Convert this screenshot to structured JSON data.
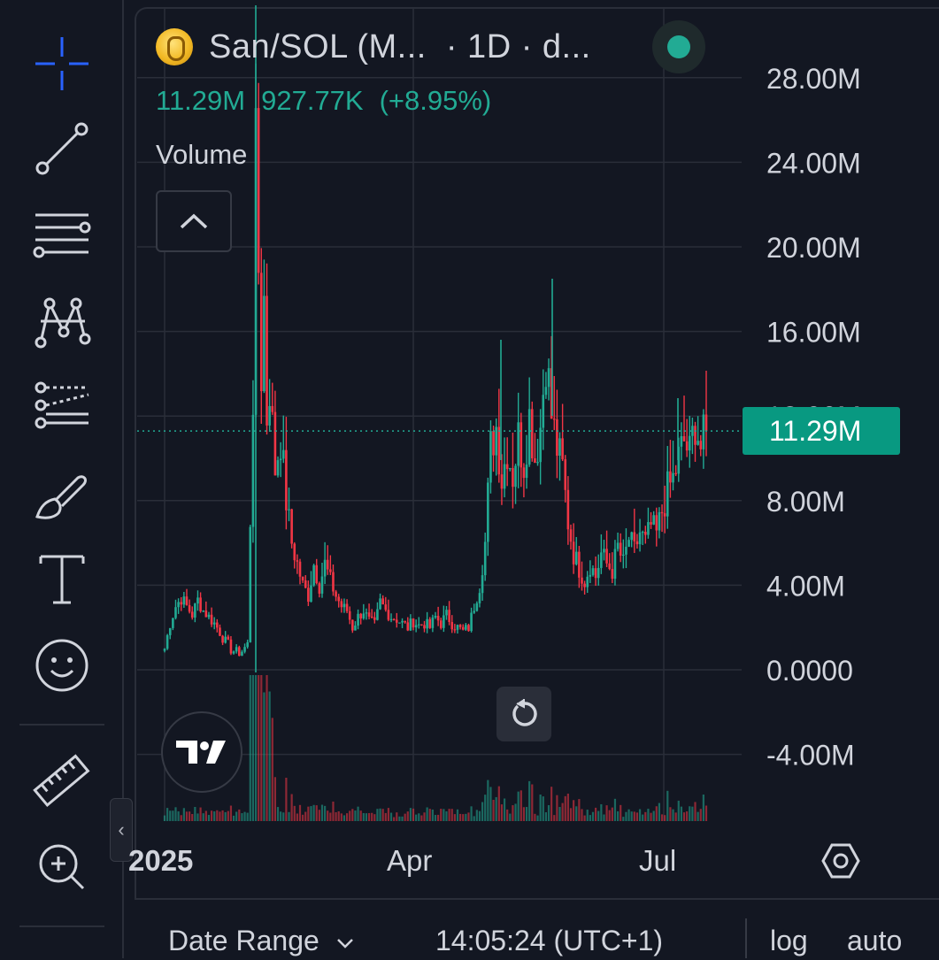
{
  "legend": {
    "symbol_title": "San/SOL (M...",
    "interval": "· 1D · d...",
    "last_value": "11.29M",
    "change": "927.77K",
    "change_pct": "(+8.95%)",
    "indicator_label": "Volume",
    "status_color": "#22ab94"
  },
  "price_axis": {
    "labels": [
      "28.00M",
      "24.00M",
      "20.00M",
      "16.00M",
      "12.00M",
      "8.00M",
      "4.00M",
      "0.0000",
      "-4.00M"
    ],
    "current_badge": "11.29M"
  },
  "time_axis": {
    "labels": [
      "2025",
      "Apr",
      "Jul"
    ]
  },
  "bottom_bar": {
    "date_range": "Date Range",
    "clock": "14:05:24 (UTC+1)",
    "log": "log",
    "auto": "auto"
  },
  "toolbar": {
    "tools": [
      "crosshair-icon",
      "trend-line-icon",
      "horizontal-lines-icon",
      "pattern-icon",
      "forecast-icon",
      "brush-icon",
      "text-icon",
      "emoji-icon",
      "ruler-icon",
      "zoom-in-icon"
    ]
  },
  "colors": {
    "up": "#22ab94",
    "down": "#f23645",
    "background": "#131722",
    "grid": "#2a2e39"
  },
  "chart_data": {
    "type": "candlestick",
    "ylim": [
      -6000000,
      30000000
    ],
    "y_ticks": [
      28000000,
      24000000,
      20000000,
      16000000,
      12000000,
      8000000,
      4000000,
      0,
      -4000000
    ],
    "current_price": 11290000,
    "x_tick_labels": [
      "2025",
      "Apr",
      "Jul"
    ],
    "close_path": [
      [
        0,
        1.0
      ],
      [
        2,
        2.2
      ],
      [
        4,
        3.0
      ],
      [
        6,
        3.4
      ],
      [
        8,
        3.0
      ],
      [
        10,
        2.6
      ],
      [
        12,
        3.3
      ],
      [
        14,
        2.8
      ],
      [
        16,
        2.5
      ],
      [
        18,
        2.2
      ],
      [
        20,
        1.8
      ],
      [
        22,
        1.3
      ],
      [
        24,
        1.0
      ],
      [
        26,
        0.8
      ],
      [
        28,
        0.9
      ],
      [
        30,
        1.2
      ],
      [
        32,
        13.0
      ],
      [
        33,
        24.0
      ],
      [
        34,
        19.0
      ],
      [
        35,
        14.0
      ],
      [
        36,
        17.5
      ],
      [
        37,
        12.0
      ],
      [
        38,
        13.5
      ],
      [
        40,
        9.5
      ],
      [
        42,
        11.0
      ],
      [
        44,
        8.0
      ],
      [
        46,
        6.0
      ],
      [
        48,
        5.0
      ],
      [
        50,
        4.0
      ],
      [
        52,
        3.5
      ],
      [
        54,
        5.0
      ],
      [
        56,
        4.0
      ],
      [
        58,
        5.0
      ],
      [
        60,
        4.2
      ],
      [
        62,
        3.5
      ],
      [
        64,
        3.0
      ],
      [
        66,
        2.8
      ],
      [
        68,
        2.0
      ],
      [
        70,
        2.5
      ],
      [
        72,
        2.8
      ],
      [
        74,
        2.3
      ],
      [
        76,
        2.1
      ],
      [
        78,
        3.2
      ],
      [
        80,
        2.8
      ],
      [
        82,
        2.5
      ],
      [
        84,
        2.4
      ],
      [
        86,
        2.2
      ],
      [
        88,
        2.0
      ],
      [
        90,
        2.3
      ],
      [
        92,
        2.1
      ],
      [
        94,
        2.2
      ],
      [
        96,
        2.0
      ],
      [
        98,
        2.5
      ],
      [
        100,
        2.2
      ],
      [
        102,
        2.6
      ],
      [
        104,
        2.2
      ],
      [
        106,
        2.0
      ],
      [
        108,
        1.8
      ],
      [
        110,
        2.0
      ],
      [
        112,
        3.0
      ],
      [
        114,
        4.0
      ],
      [
        116,
        6.0
      ],
      [
        118,
        10.5
      ],
      [
        120,
        11.5
      ],
      [
        122,
        9.0
      ],
      [
        124,
        10.5
      ],
      [
        126,
        9.2
      ],
      [
        128,
        11.0
      ],
      [
        130,
        9.8
      ],
      [
        132,
        12.0
      ],
      [
        134,
        10.0
      ],
      [
        136,
        11.5
      ],
      [
        138,
        15.0
      ],
      [
        140,
        12.0
      ],
      [
        142,
        10.5
      ],
      [
        144,
        9.5
      ],
      [
        146,
        7.0
      ],
      [
        148,
        5.5
      ],
      [
        150,
        4.8
      ],
      [
        152,
        4.2
      ],
      [
        154,
        5.0
      ],
      [
        156,
        4.4
      ],
      [
        158,
        5.5
      ],
      [
        160,
        5.0
      ],
      [
        162,
        4.7
      ],
      [
        164,
        5.8
      ],
      [
        166,
        5.0
      ],
      [
        168,
        6.2
      ],
      [
        170,
        5.6
      ],
      [
        172,
        6.5
      ],
      [
        174,
        6.0
      ],
      [
        176,
        6.8
      ],
      [
        178,
        6.4
      ],
      [
        180,
        7.5
      ],
      [
        182,
        8.5
      ],
      [
        184,
        9.0
      ],
      [
        186,
        10.0
      ],
      [
        188,
        10.8
      ],
      [
        190,
        10.2
      ],
      [
        192,
        11.8
      ],
      [
        194,
        10.5
      ],
      [
        196,
        11.29
      ]
    ]
  }
}
